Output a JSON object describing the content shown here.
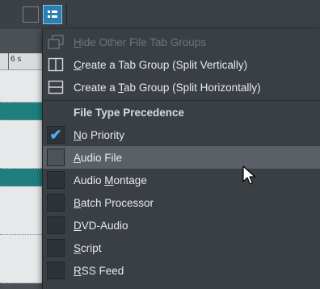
{
  "toolbar": {
    "buttons": [
      {
        "name": "tab-layout-button",
        "icon": "square-outline-icon",
        "active": false
      },
      {
        "name": "tab-group-menu-button",
        "icon": "list-menu-icon",
        "active": true
      }
    ]
  },
  "editor": {
    "ruler_label": "6 s"
  },
  "menu": {
    "items": [
      {
        "type": "item",
        "label": "Hide Other File Tab Groups",
        "mnemonic": "H",
        "icon": "hide-tab-groups-icon",
        "enabled": false
      },
      {
        "type": "item",
        "label": "Create a Tab Group (Split Vertically)",
        "mnemonic": "C",
        "icon": "split-vertical-icon",
        "enabled": true
      },
      {
        "type": "item",
        "label": "Create a Tab Group (Split Horizontally)",
        "mnemonic": "T",
        "icon": "split-horizontal-icon",
        "enabled": true
      },
      {
        "type": "header",
        "label": "File Type Precedence"
      },
      {
        "type": "check",
        "label": "No Priority",
        "mnemonic": "N",
        "checked": true
      },
      {
        "type": "check",
        "label": "Audio File",
        "mnemonic": "A",
        "checked": false,
        "highlighted": true
      },
      {
        "type": "check",
        "label": "Audio Montage",
        "mnemonic": "M",
        "checked": false
      },
      {
        "type": "check",
        "label": "Batch Processor",
        "mnemonic": "B",
        "checked": false
      },
      {
        "type": "check",
        "label": "DVD-Audio",
        "mnemonic": "D",
        "checked": false
      },
      {
        "type": "check",
        "label": "Script",
        "mnemonic": "S",
        "checked": false
      },
      {
        "type": "check",
        "label": "RSS Feed",
        "mnemonic": "R",
        "checked": false
      }
    ]
  },
  "colors": {
    "accent": "#2a7fb3",
    "check": "#4fb0ef",
    "menu_bg": "#3a3f44",
    "highlight": "#5a6066",
    "teal_lane": "#1f7f7f"
  }
}
